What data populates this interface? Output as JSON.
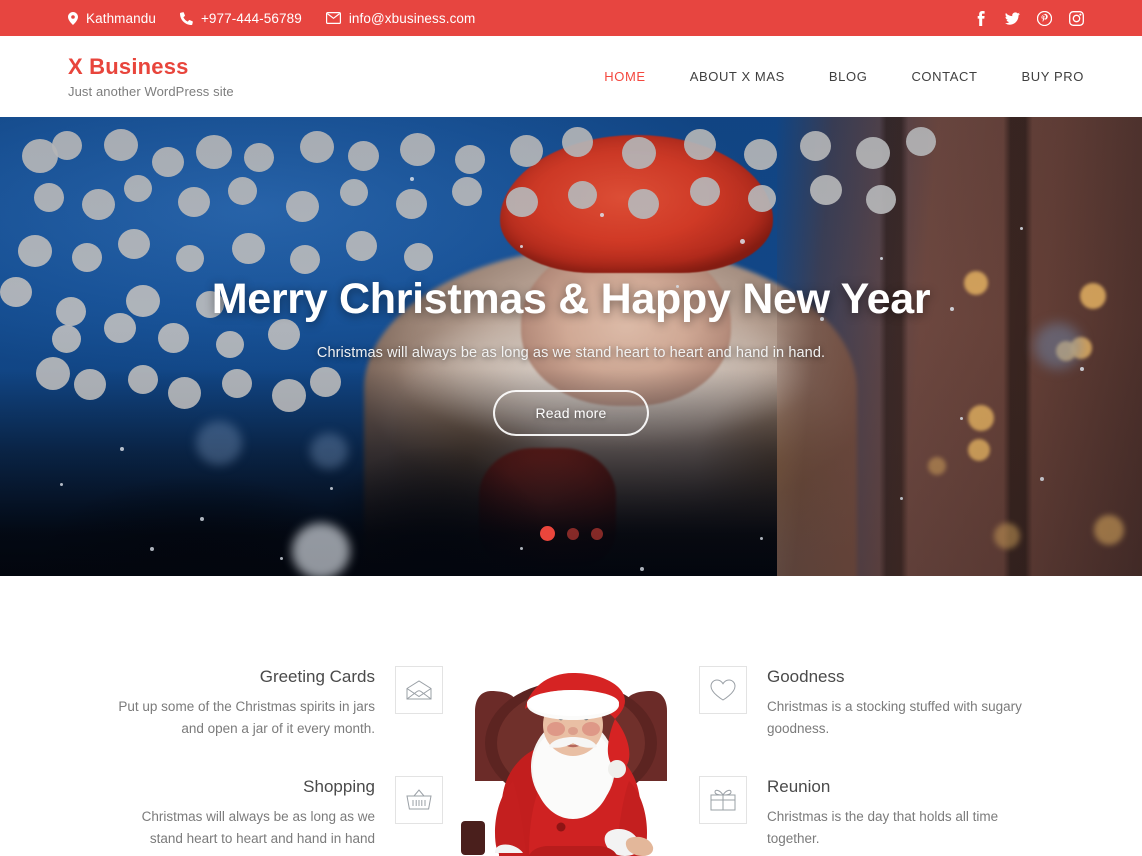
{
  "topbar": {
    "location": "Kathmandu",
    "phone": "+977-444-56789",
    "email": "info@xbusiness.com",
    "icons": {
      "location": "map-pin-icon",
      "phone": "phone-icon",
      "email": "envelope-icon"
    },
    "social": [
      {
        "name": "facebook-icon",
        "label": "Facebook"
      },
      {
        "name": "twitter-icon",
        "label": "Twitter"
      },
      {
        "name": "pinterest-icon",
        "label": "Pinterest"
      },
      {
        "name": "instagram-icon",
        "label": "Instagram"
      }
    ],
    "background_color": "#e74540"
  },
  "header": {
    "site_title": "X Business",
    "tagline": "Just another WordPress site",
    "brand_color": "#e8453c",
    "nav": [
      {
        "label": "HOME",
        "active": true
      },
      {
        "label": "ABOUT X MAS",
        "active": false
      },
      {
        "label": "BLOG",
        "active": false
      },
      {
        "label": "CONTACT",
        "active": false
      },
      {
        "label": "BUY PRO",
        "active": false
      }
    ]
  },
  "hero": {
    "title": "Merry Christmas & Happy New Year",
    "subtitle": "Christmas will always be as long as we stand heart to heart and hand in hand.",
    "button_label": "Read more",
    "slides": 3,
    "active_slide": 1,
    "accent_color": "#ea463c"
  },
  "features": {
    "left": [
      {
        "title": "Greeting Cards",
        "desc": "Put up some of the Christmas spirits in jars and open a jar of it every month.",
        "icon": "envelope-open-icon"
      },
      {
        "title": "Shopping",
        "desc": "Christmas will always be as long as we stand heart to heart and hand in hand",
        "icon": "shopping-basket-icon"
      }
    ],
    "right": [
      {
        "title": "Goodness",
        "desc": "Christmas is a stocking stuffed with sugary goodness.",
        "icon": "heart-icon"
      },
      {
        "title": "Reunion",
        "desc": "Christmas is the day that holds all time together.",
        "icon": "gift-box-icon"
      }
    ],
    "center_image": "santa-in-chair-illustration"
  }
}
